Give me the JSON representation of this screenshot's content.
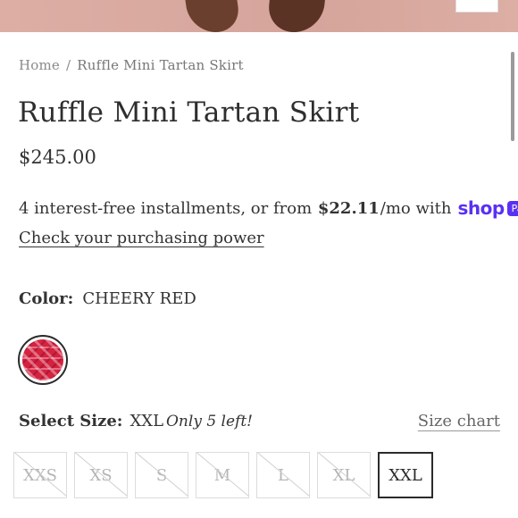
{
  "breadcrumb": {
    "home": "Home",
    "separator": "/",
    "current": "Ruffle Mini Tartan Skirt"
  },
  "product": {
    "title": "Ruffle Mini Tartan Skirt",
    "price": "$245.00"
  },
  "installments": {
    "prefix": "4 interest-free installments, or from",
    "amount": "$22.11",
    "suffix": "/mo with",
    "brand_shop": "shop",
    "brand_pay": "Pay",
    "check_link": "Check your purchasing power"
  },
  "color": {
    "label": "Color:",
    "value": "CHEERY RED",
    "swatch_color": "#d4223f"
  },
  "size": {
    "label": "Select Size:",
    "value": "XXL",
    "stock_note": "Only 5 left!",
    "chart_link": "Size chart",
    "options": [
      {
        "label": "XXS",
        "available": false
      },
      {
        "label": "XS",
        "available": false
      },
      {
        "label": "S",
        "available": false
      },
      {
        "label": "M",
        "available": false
      },
      {
        "label": "L",
        "available": false
      },
      {
        "label": "XL",
        "available": false
      },
      {
        "label": "XXL",
        "available": true,
        "selected": true
      }
    ]
  },
  "colors": {
    "brand_shop_pay": "#5a31f4",
    "text": "#2b2b2b"
  }
}
